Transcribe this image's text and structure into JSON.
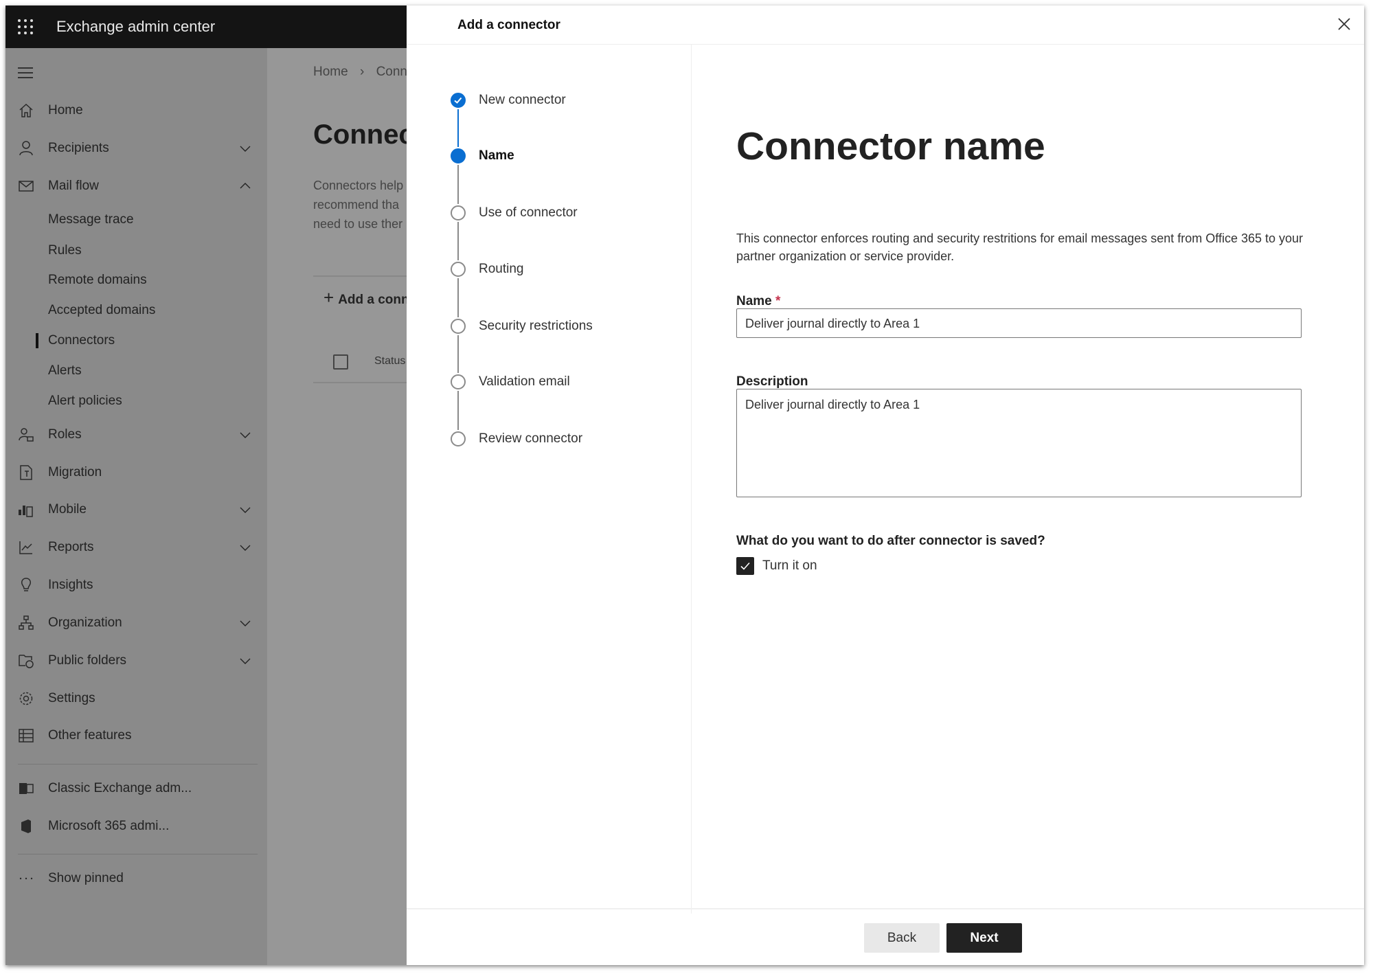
{
  "app": {
    "title": "Exchange admin center"
  },
  "sidebar": {
    "items": [
      {
        "label": "Home",
        "icon": "home-icon"
      },
      {
        "label": "Recipients",
        "icon": "person-icon",
        "chevron": "down"
      },
      {
        "label": "Mail flow",
        "icon": "mail-icon",
        "chevron": "up"
      },
      {
        "label": "Message trace",
        "sub": true
      },
      {
        "label": "Rules",
        "sub": true
      },
      {
        "label": "Remote domains",
        "sub": true
      },
      {
        "label": "Accepted domains",
        "sub": true
      },
      {
        "label": "Connectors",
        "sub": true,
        "selected": true
      },
      {
        "label": "Alerts",
        "sub": true
      },
      {
        "label": "Alert policies",
        "sub": true
      },
      {
        "label": "Roles",
        "icon": "roles-icon",
        "chevron": "down"
      },
      {
        "label": "Migration",
        "icon": "migration-icon"
      },
      {
        "label": "Mobile",
        "icon": "mobile-icon",
        "chevron": "down"
      },
      {
        "label": "Reports",
        "icon": "chart-icon",
        "chevron": "down"
      },
      {
        "label": "Insights",
        "icon": "lightbulb-icon"
      },
      {
        "label": "Organization",
        "icon": "org-icon",
        "chevron": "down"
      },
      {
        "label": "Public folders",
        "icon": "public-folder-icon",
        "chevron": "down"
      },
      {
        "label": "Settings",
        "icon": "gear-icon"
      },
      {
        "label": "Other features",
        "icon": "table-icon"
      },
      {
        "label": "Classic Exchange adm...",
        "icon": "exchange-icon"
      },
      {
        "label": "Microsoft 365 admi...",
        "icon": "office-icon"
      },
      {
        "label": "Show pinned",
        "icon": "more-icon"
      }
    ]
  },
  "background": {
    "breadcrumb": [
      "Home",
      "Conne"
    ],
    "heading": "Connec",
    "description": [
      "Connectors help",
      "recommend tha",
      "need to use ther"
    ],
    "add_button": "Add a conn",
    "column_status": "Status"
  },
  "panel": {
    "header": "Add a connector",
    "steps": [
      {
        "label": "New connector",
        "state": "done"
      },
      {
        "label": "Name",
        "state": "current"
      },
      {
        "label": "Use of connector",
        "state": "todo"
      },
      {
        "label": "Routing",
        "state": "todo"
      },
      {
        "label": "Security restrictions",
        "state": "todo"
      },
      {
        "label": "Validation email",
        "state": "todo"
      },
      {
        "label": "Review connector",
        "state": "todo"
      }
    ],
    "title": "Connector name",
    "description": "This connector enforces routing and security restritions for email messages sent from Office 365 to your partner organization or service provider.",
    "name_label": "Name",
    "required_mark": "*",
    "name_value": "Deliver journal directly to Area 1",
    "description_label": "Description",
    "description_value": "Deliver journal directly to Area 1",
    "after_save_question": "What do you want to do after connector is saved?",
    "turn_on_label": "Turn it on",
    "turn_on_checked": true,
    "back_label": "Back",
    "next_label": "Next"
  },
  "colors": {
    "accent": "#0a6ed1",
    "topbar": "#141414",
    "primary_button": "#222222"
  }
}
